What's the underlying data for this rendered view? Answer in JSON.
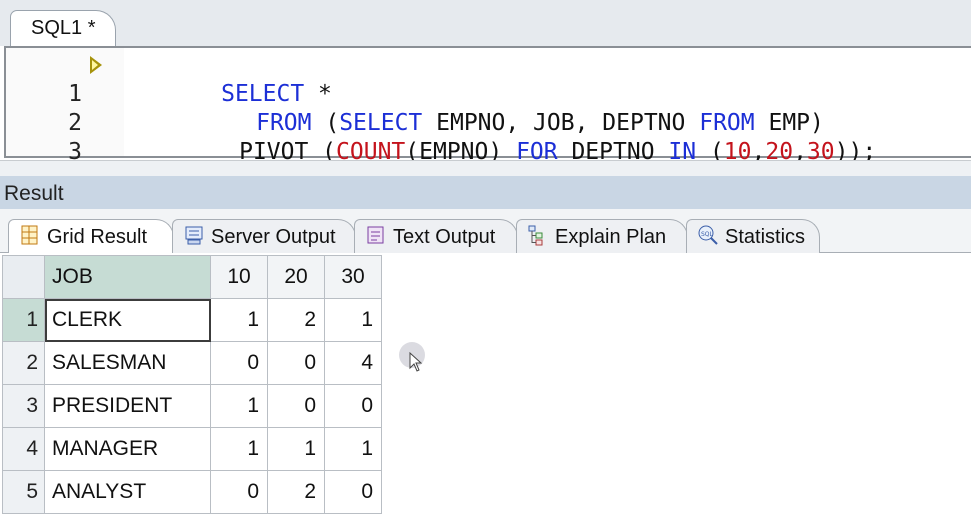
{
  "editor": {
    "tab_label": "SQL1 *",
    "lines": [
      {
        "num": "1"
      },
      {
        "num": "2"
      },
      {
        "num": "3"
      }
    ],
    "tokens": {
      "l1_select": "SELECT",
      "l1_star": " *",
      "l2_from": "FROM",
      "l2_open": " (",
      "l2_select": "SELECT",
      "l2_cols": " EMPNO, JOB, DEPTNO ",
      "l2_from2": "FROM",
      "l2_tail": " EMP)",
      "l3_pivot": "PIVOT (",
      "l3_count": "COUNT",
      "l3_mid": "(EMPNO) ",
      "l3_for": "FOR",
      "l3_deptno": " DEPTNO ",
      "l3_in": "IN",
      "l3_open": " (",
      "l3_n10": "10",
      "l3_c1": ",",
      "l3_n20": "20",
      "l3_c2": ",",
      "l3_n30": "30",
      "l3_close": "));"
    }
  },
  "result": {
    "header": "Result",
    "tabs": [
      {
        "label": "Grid Result",
        "icon": "grid-icon"
      },
      {
        "label": "Server Output",
        "icon": "server-output-icon"
      },
      {
        "label": "Text Output",
        "icon": "text-output-icon"
      },
      {
        "label": "Explain Plan",
        "icon": "explain-plan-icon"
      },
      {
        "label": "Statistics",
        "icon": "statistics-icon"
      }
    ],
    "columns": [
      "JOB",
      "10",
      "20",
      "30"
    ],
    "rows": [
      {
        "n": "1",
        "job": "CLERK",
        "v10": "1",
        "v20": "2",
        "v30": "1"
      },
      {
        "n": "2",
        "job": "SALESMAN",
        "v10": "0",
        "v20": "0",
        "v30": "4"
      },
      {
        "n": "3",
        "job": "PRESIDENT",
        "v10": "1",
        "v20": "0",
        "v30": "0"
      },
      {
        "n": "4",
        "job": "MANAGER",
        "v10": "1",
        "v20": "1",
        "v30": "1"
      },
      {
        "n": "5",
        "job": "ANALYST",
        "v10": "0",
        "v20": "2",
        "v30": "0"
      }
    ]
  },
  "colors": {
    "keyword": "#1c2fd6",
    "number": "#c4131c",
    "header_bg": "#c9d6e4",
    "selection": "#c6dcd4"
  }
}
